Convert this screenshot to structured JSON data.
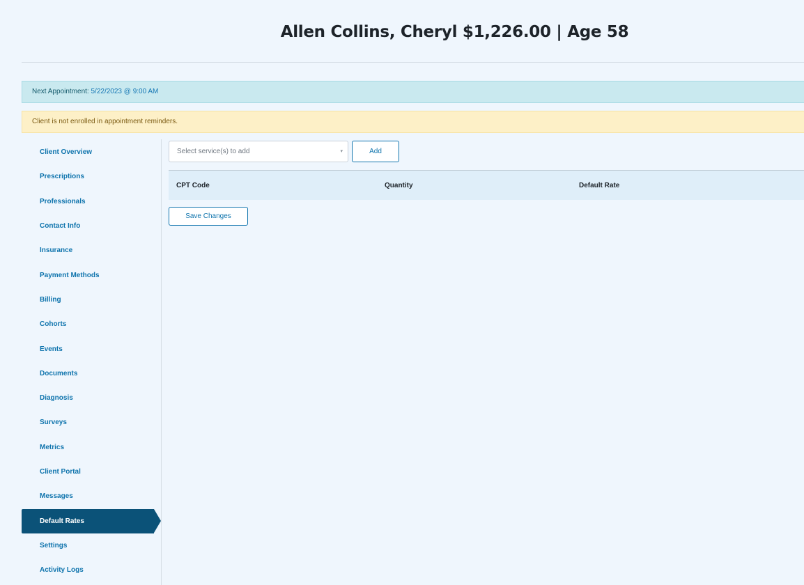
{
  "header": {
    "client_title": "Allen Collins, Cheryl $1,226.00 | Age 58"
  },
  "alerts": {
    "appointment_label": "Next Appointment: ",
    "appointment_value": "5/22/2023 @ 9:00 AM",
    "reminder_text": "Client is not enrolled in appointment reminders."
  },
  "sidebar": {
    "items": [
      {
        "label": "Client Overview"
      },
      {
        "label": "Prescriptions"
      },
      {
        "label": "Professionals"
      },
      {
        "label": "Contact Info"
      },
      {
        "label": "Insurance"
      },
      {
        "label": "Payment Methods"
      },
      {
        "label": "Billing"
      },
      {
        "label": "Cohorts"
      },
      {
        "label": "Events"
      },
      {
        "label": "Documents"
      },
      {
        "label": "Diagnosis"
      },
      {
        "label": "Surveys"
      },
      {
        "label": "Metrics"
      },
      {
        "label": "Client Portal"
      },
      {
        "label": "Messages"
      },
      {
        "label": "Default Rates"
      },
      {
        "label": "Settings"
      },
      {
        "label": "Activity Logs"
      }
    ],
    "active_item": "Default Rates"
  },
  "content": {
    "service_select_placeholder": "Select service(s) to add",
    "select_arrow_icon": "caret-down-icon",
    "add_label": "Add",
    "table_headers": [
      "CPT Code",
      "Quantity",
      "Default Rate"
    ],
    "save_label": "Save Changes"
  },
  "colors": {
    "page_background": "#eff6fd",
    "accent": "#0f74ad",
    "active_nav": "#0b5278",
    "info_alert": "#c9e9ef",
    "warning_alert": "#fdf0c7"
  }
}
